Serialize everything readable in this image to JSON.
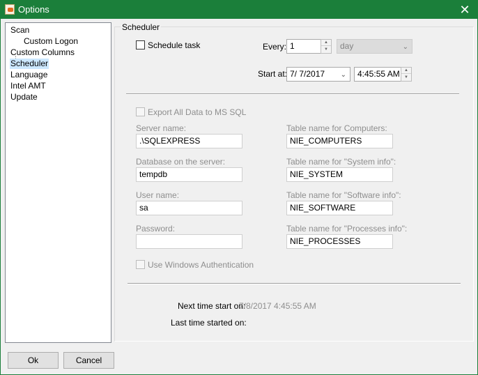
{
  "window": {
    "title": "Options",
    "accent": "#1b7f3a"
  },
  "tree": {
    "items": [
      {
        "label": "Scan"
      },
      {
        "label": "Custom Logon"
      },
      {
        "label": "Custom Columns"
      },
      {
        "label": "Scheduler"
      },
      {
        "label": "Language"
      },
      {
        "label": "Intel AMT"
      },
      {
        "label": "Update"
      }
    ],
    "selected": "Scheduler"
  },
  "scheduler": {
    "group_title": "Scheduler",
    "schedule_task_label": "Schedule task",
    "every_label": "Every:",
    "every_value": "1",
    "interval_value": "day",
    "start_at_label": "Start at:",
    "start_date": "7/  7/2017",
    "start_time": "4:45:55 AM"
  },
  "sql": {
    "export_label": "Export All Data to MS SQL",
    "server_name_label": "Server name:",
    "server_name_value": ".\\SQLEXPRESS",
    "database_label": "Database on the server:",
    "database_value": "tempdb",
    "user_label": "User name:",
    "user_value": "sa",
    "password_label": "Password:",
    "password_value": "",
    "windows_auth_label": "Use Windows Authentication",
    "tbl_computers_label": "Table name for Computers:",
    "tbl_computers_value": "NIE_COMPUTERS",
    "tbl_system_label": "Table name for \"System info\":",
    "tbl_system_value": "NIE_SYSTEM",
    "tbl_software_label": "Table name for \"Software info\":",
    "tbl_software_value": "NIE_SOFTWARE",
    "tbl_processes_label": "Table name for \"Processes info\":",
    "tbl_processes_value": "NIE_PROCESSES"
  },
  "status": {
    "next_label": "Next time start on:",
    "next_value": "7/8/2017 4:45:55 AM",
    "last_label": "Last time started on:",
    "last_value": ""
  },
  "buttons": {
    "ok": "Ok",
    "cancel": "Cancel"
  }
}
